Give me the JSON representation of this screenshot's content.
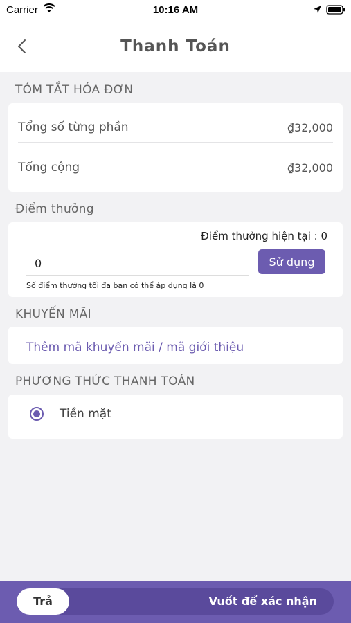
{
  "status_bar": {
    "carrier": "Carrier",
    "time": "10:16 AM"
  },
  "nav": {
    "title": "Thanh Toán"
  },
  "invoice": {
    "section_title": "TÓM TẮT HÓA ĐƠN",
    "subtotal_label": "Tổng số từng phần",
    "subtotal_value": "₫32,000",
    "total_label": "Tổng cộng",
    "total_value": "₫32,000"
  },
  "points": {
    "section_title": "Điểm thưởng",
    "current_text": "Điểm thưởng hiện tại : 0",
    "input_value": "0",
    "use_button_label": "Sử dụng",
    "hint": "Số điểm thưởng tối đa bạn có thể áp dụng là 0"
  },
  "promotion": {
    "section_title": "KHUYẾN MÃI",
    "link_text": "Thêm mã khuyến mãi / mã giới thiệu"
  },
  "payment": {
    "section_title": "PHƯƠNG THỨC THANH TOÁN",
    "method_label": "Tiền mặt",
    "selected": true
  },
  "footer": {
    "slider_thumb_label": "Trả",
    "slider_text": "Vuốt để xác nhận"
  },
  "colors": {
    "accent": "#6c5cb0",
    "background": "#f2f2f4"
  }
}
